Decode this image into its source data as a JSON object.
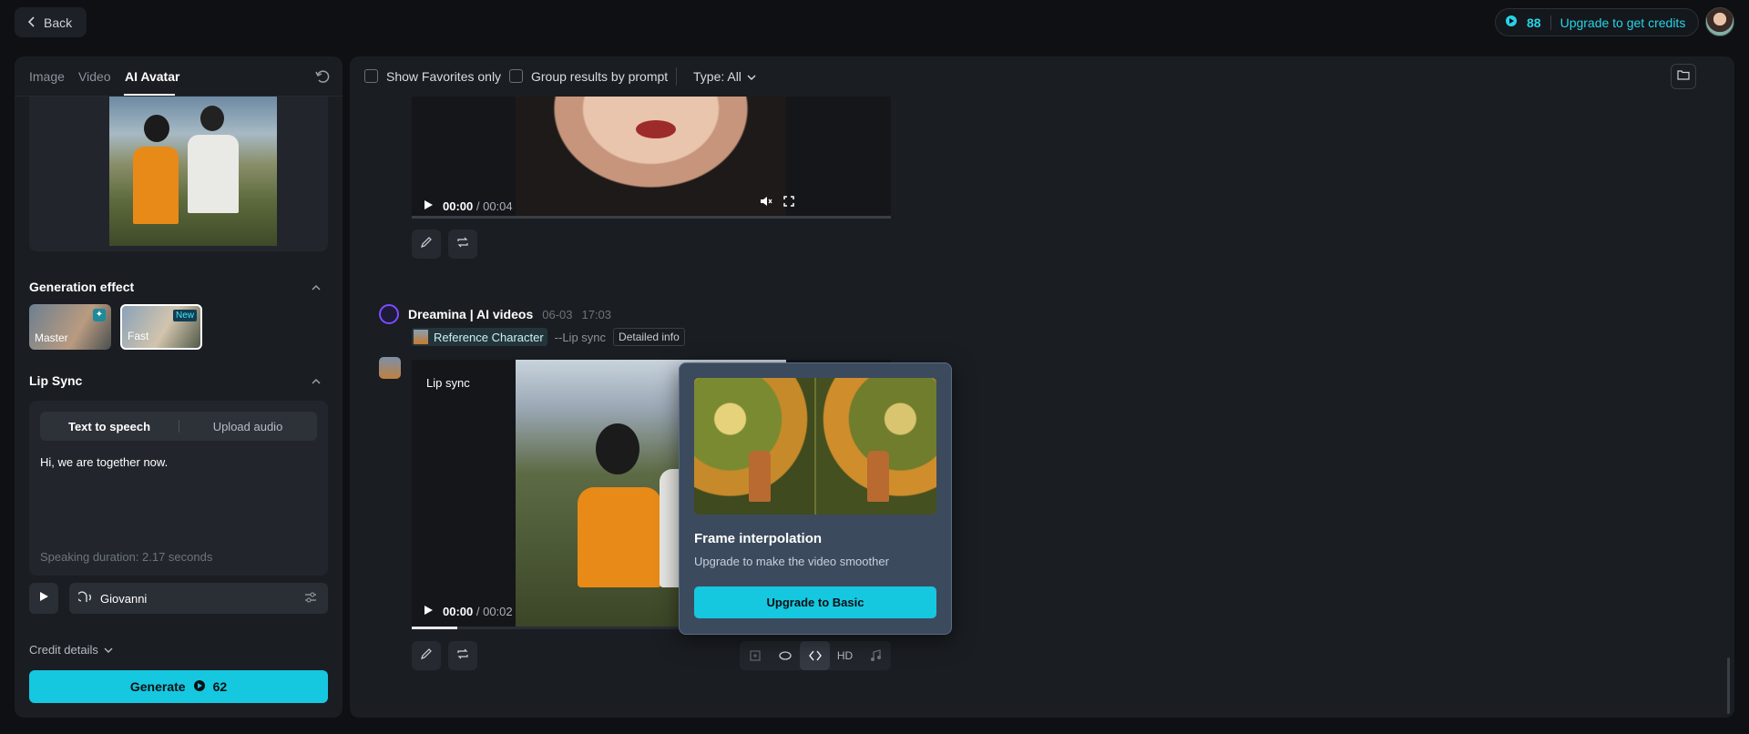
{
  "topbar": {
    "back_label": "Back",
    "credits_count": "88",
    "upgrade_label": "Upgrade to get credits"
  },
  "left_panel": {
    "tabs": [
      {
        "label": "Image"
      },
      {
        "label": "Video"
      },
      {
        "label": "AI Avatar"
      }
    ],
    "active_tab": "AI Avatar",
    "generation_effect": {
      "title": "Generation effect",
      "options": [
        {
          "label": "Master",
          "badge": "✦"
        },
        {
          "label": "Fast",
          "badge": "New"
        }
      ]
    },
    "lip_sync": {
      "title": "Lip Sync",
      "modes": [
        {
          "label": "Text to speech"
        },
        {
          "label": "Upload audio"
        }
      ],
      "active_mode": "Text to speech",
      "text_value": "Hi, we are together now.",
      "duration": "Speaking duration: 2.17 seconds",
      "voice": "Giovanni"
    },
    "credit_details_label": "Credit details",
    "generate": {
      "label": "Generate",
      "cost": "62"
    }
  },
  "main": {
    "filters": {
      "show_favorites": "Show Favorites only",
      "group_results": "Group results by prompt",
      "type": "Type: All"
    },
    "video1": {
      "current_time": "00:00",
      "total_time": "/ 00:04"
    },
    "generation": {
      "name": "Dreamina | AI videos",
      "date": "06-03",
      "time": "17:03",
      "reference_label": "Reference Character",
      "lip_tag": "--Lip sync",
      "detail_label": "Detailed info"
    },
    "video2": {
      "label": "Lip sync",
      "current_time": "00:00",
      "total_time": "/ 00:02"
    },
    "tools": {
      "hd_label": "HD"
    }
  },
  "popover": {
    "title": "Frame interpolation",
    "subtitle": "Upgrade to make the video smoother",
    "button": "Upgrade to Basic"
  },
  "colors": {
    "accent": "#16c7e0",
    "brand_purple": "#7a4dff",
    "panel": "#1a1d22",
    "background": "#0e1013"
  }
}
